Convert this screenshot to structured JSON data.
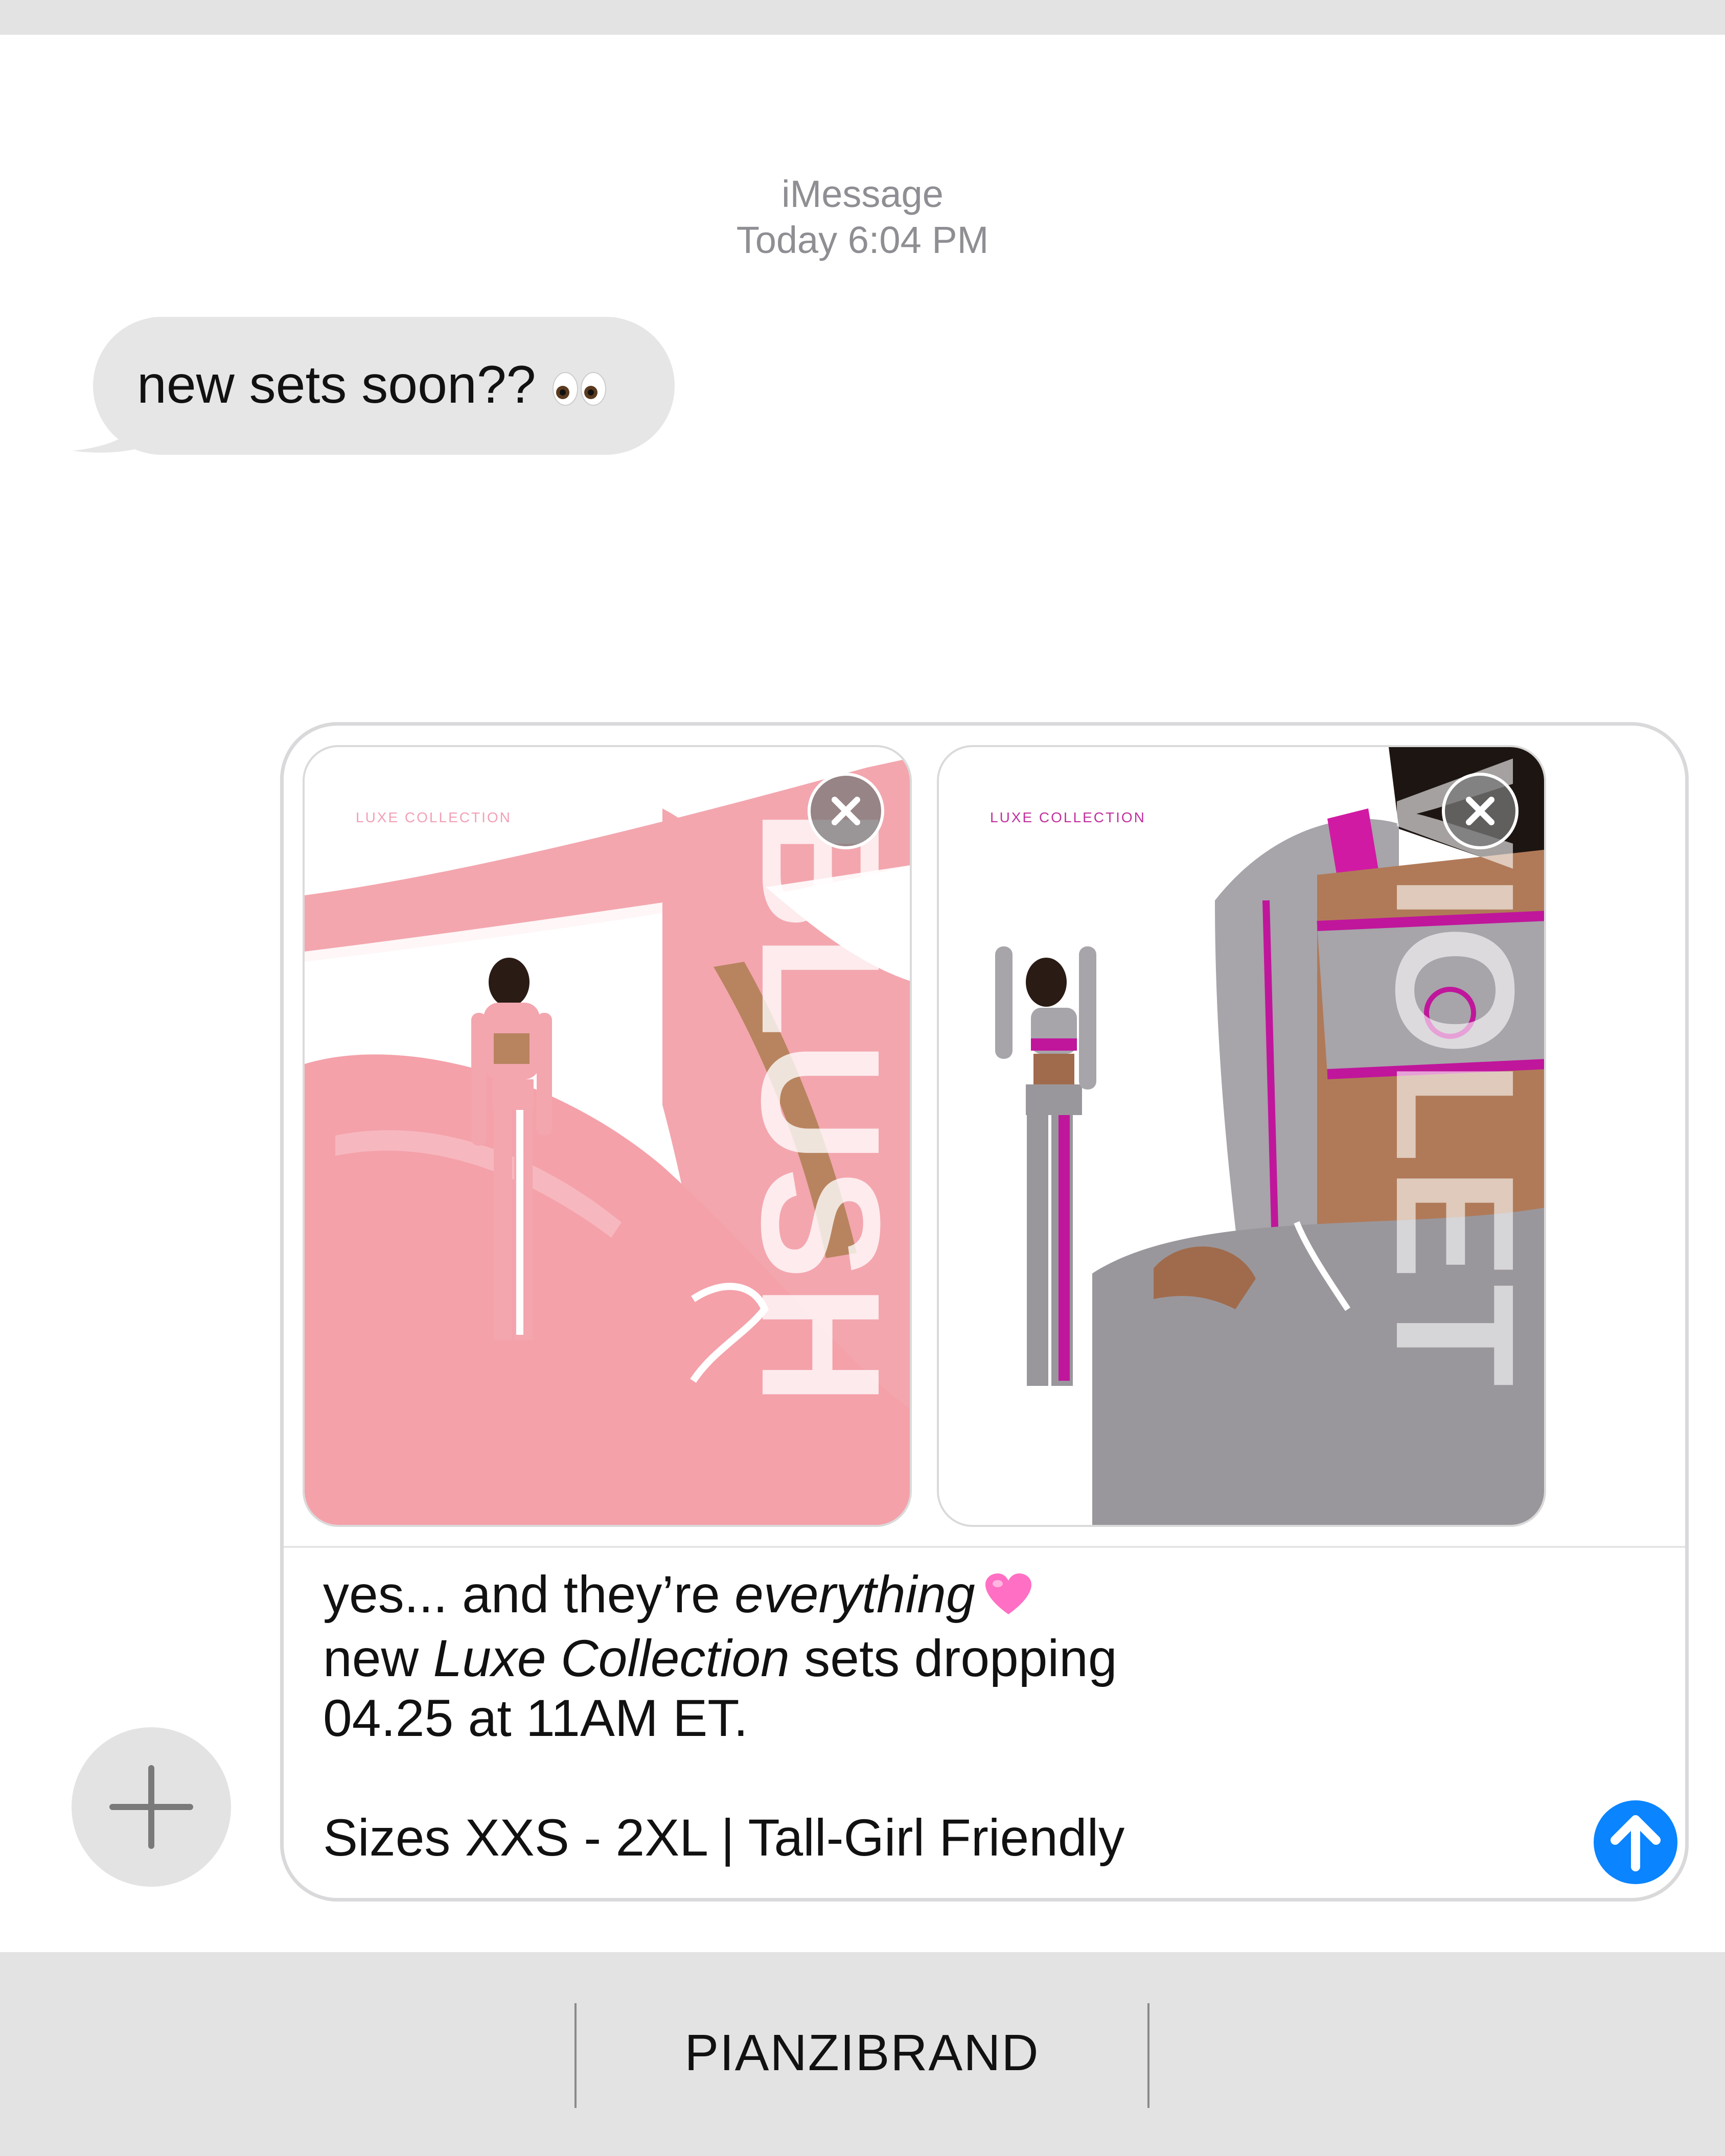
{
  "conversation": {
    "service": "iMessage",
    "timestamp": "Today 6:04 PM"
  },
  "incoming_message": {
    "text": "new sets soon??",
    "emoji": "eyes"
  },
  "compose": {
    "attachments": [
      {
        "label": "LUXE COLLECTION",
        "word": "BLUSH",
        "remove_icon": "close-icon"
      },
      {
        "label": "LUXE COLLECTION",
        "word": "VIOLET",
        "remove_icon": "close-icon"
      }
    ],
    "message": {
      "line1_a": "yes... and they’re ",
      "line1_em": "everything",
      "line1_emoji": "pink-heart",
      "line2_a": "new ",
      "line2_em": "Luxe Collection",
      "line2_b": " sets dropping",
      "line3": "04.25 at 11AM ET.",
      "line4": "Sizes XXS - 2XL | Tall-Girl Friendly"
    },
    "send_icon": "arrow-up-icon",
    "send_color": "#0a84ff"
  },
  "add_button": {
    "icon": "plus-icon"
  },
  "bottom_bar": {
    "label": "PIANZIBRAND"
  },
  "colors": {
    "incoming_bubble": "#e6e6e6",
    "blush": "#f3a6ae",
    "violet": "#c0169b",
    "gray_fabric": "#9a979c"
  }
}
